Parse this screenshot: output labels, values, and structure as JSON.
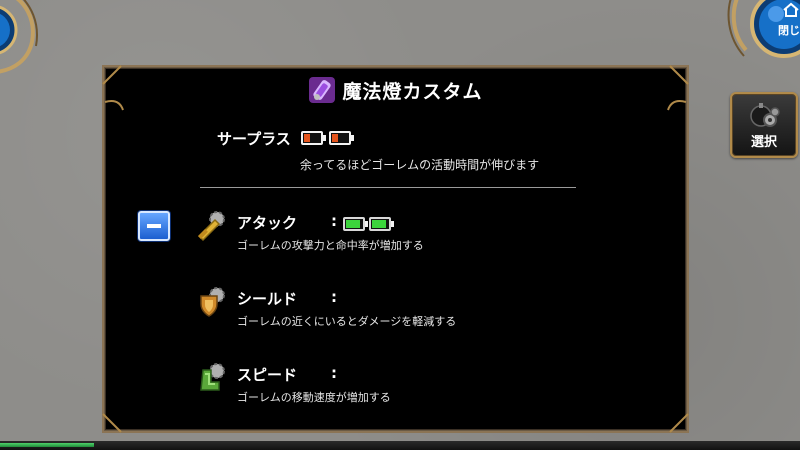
{
  "panel": {
    "title": "魔法燈カスタム",
    "surplus_label": "サープラス",
    "surplus_desc": "余ってるほどゴーレムの活動時間が伸びます"
  },
  "stats": [
    {
      "name": "アタック",
      "colon": ":",
      "desc": "ゴーレムの攻撃力と命中率が増加する",
      "level": 2
    },
    {
      "name": "シールド",
      "colon": ":",
      "desc": "ゴーレムの近くにいるとダメージを軽減する",
      "level": 0
    },
    {
      "name": "スピード",
      "colon": ":",
      "desc": "ゴーレムの移動速度が増加する",
      "level": 0
    }
  ],
  "surplus_batteries": 2,
  "top_right": {
    "close_label": "閉じ"
  },
  "side": {
    "select_label": "選択"
  },
  "icons": {
    "title": "crystal-lamp-icon",
    "attack": "sword-gear-icon",
    "shield": "shield-gear-icon",
    "speed": "boot-gear-icon",
    "select": "gear-bomb-icon",
    "close": "home-icon"
  },
  "colors": {
    "surplus_battery": "#e4551e",
    "stat_battery": "#3cd43c",
    "minus_button": "#1c5fd0",
    "frame": "#b08a4a"
  }
}
